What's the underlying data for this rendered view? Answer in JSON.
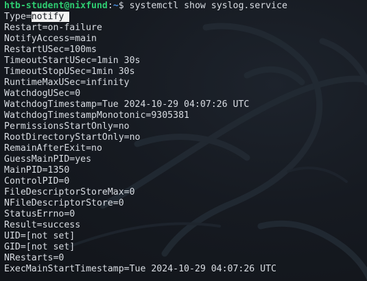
{
  "prompt": {
    "user_host": "htb-student@nixfund",
    "separator": ":",
    "path": "~",
    "symbol": "$",
    "command": "systemctl show syslog.service"
  },
  "first_line": {
    "key": "Type=",
    "value": "notify"
  },
  "output_lines": [
    "Restart=on-failure",
    "NotifyAccess=main",
    "RestartUSec=100ms",
    "TimeoutStartUSec=1min 30s",
    "TimeoutStopUSec=1min 30s",
    "RuntimeMaxUSec=infinity",
    "WatchdogUSec=0",
    "WatchdogTimestamp=Tue 2024-10-29 04:07:26 UTC",
    "WatchdogTimestampMonotonic=9305381",
    "PermissionsStartOnly=no",
    "RootDirectoryStartOnly=no",
    "RemainAfterExit=no",
    "GuessMainPID=yes",
    "MainPID=1350",
    "ControlPID=0",
    "FileDescriptorStoreMax=0",
    "NFileDescriptorStore=0",
    "StatusErrno=0",
    "Result=success",
    "UID=[not set]",
    "GID=[not set]",
    "NRestarts=0",
    "ExecMainStartTimestamp=Tue 2024-10-29 04:07:26 UTC"
  ]
}
